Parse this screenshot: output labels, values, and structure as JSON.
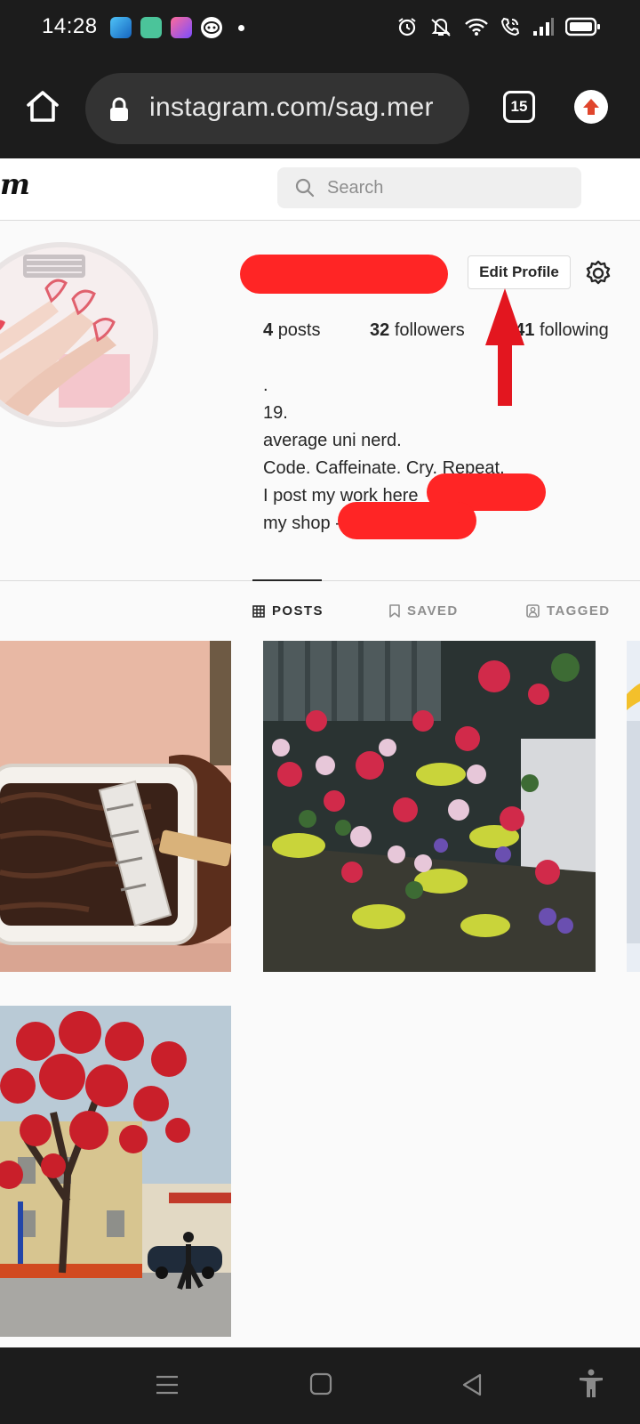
{
  "status_bar": {
    "time": "14:28",
    "app_icons": [
      "app-icon-blue",
      "app-icon-green",
      "app-icon-gradient",
      "app-icon-chat"
    ],
    "system_icons": [
      "alarm-icon",
      "mute-icon",
      "wifi-icon",
      "wifi-call-icon",
      "signal-icon",
      "battery-icon"
    ]
  },
  "browser": {
    "url": "instagram.com/sag.mer",
    "tab_count": "15"
  },
  "instagram_header": {
    "logo_fragment": "m",
    "search_placeholder": "Search"
  },
  "profile": {
    "username": "",
    "edit_button": "Edit Profile",
    "stats": {
      "posts_count": "4",
      "posts_label": "posts",
      "followers_count": "32",
      "followers_label": "followers",
      "following_count": "141",
      "following_label": "following"
    },
    "bio": [
      ".",
      "19.",
      "average uni nerd.",
      "Code. Caffeinate. Cry. Repeat.",
      "I post my work here",
      "my shop -"
    ]
  },
  "tabs": [
    {
      "label": "POSTS",
      "icon": "grid-icon",
      "active": true
    },
    {
      "label": "SAVED",
      "icon": "bookmark-icon",
      "active": false
    },
    {
      "label": "TAGGED",
      "icon": "tag-person-icon",
      "active": false
    }
  ],
  "posts": [
    {
      "subject": "brownie-with-chocolate-bar"
    },
    {
      "subject": "potted-flowers"
    },
    {
      "subject": "partial-post"
    },
    {
      "subject": "red-flowering-tree"
    }
  ],
  "colors": {
    "redaction": "#ff2525",
    "annotation_arrow": "#e3161f",
    "browser_chrome": "#1c1c1c"
  }
}
